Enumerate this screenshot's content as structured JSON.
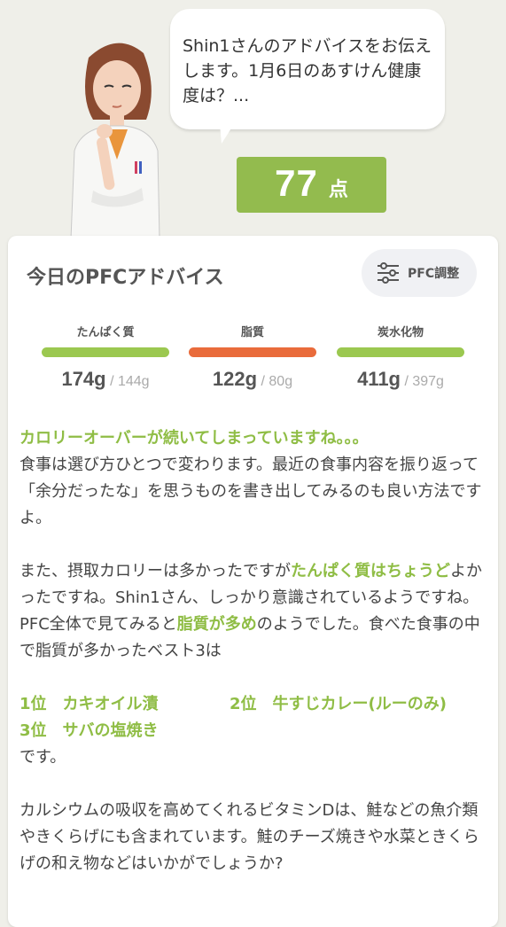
{
  "speech": {
    "text": "Shin1さんのアドバイスをお伝えします。1月6日のあすけん健康度は？..."
  },
  "score": {
    "value": "77",
    "unit": "点"
  },
  "card": {
    "title": "今日のPFCアドバイス",
    "pfc_button": "PFC調整"
  },
  "nutrients": [
    {
      "label": "たんぱく質",
      "value": "174g",
      "target": "144g",
      "color": "#9bc850"
    },
    {
      "label": "脂質",
      "value": "122g",
      "target": "80g",
      "color": "#e96b3b"
    },
    {
      "label": "炭水化物",
      "value": "411g",
      "target": "397g",
      "color": "#9bc850"
    }
  ],
  "advice": {
    "p1_headline": "カロリーオーバーが続いてしまっていますね。。。",
    "p1_body": "食事は選び方ひとつで変わります。最近の食事内容を振り返って「余分だったな」を思うものを書き出してみるのも良い方法ですよ。",
    "p2_a": "また、摂取カロリーは多かったですが",
    "p2_hl": "たんぱく質はちょうど",
    "p2_b": "よかったですね。Shin1さん、しっかり意識されているようですね。",
    "p3_a": "PFC全体で見てみると",
    "p3_hl": "脂質が多め",
    "p3_b": "のようでした。食べた食事の中で脂質が多かったベスト3は",
    "rank1": "1位　カキオイル漬",
    "rank2": "2位　牛すじカレー(ルーのみ)",
    "rank3": "3位　サバの塩焼き",
    "desu": "です。",
    "p4": "カルシウムの吸収を高めてくれるビタミンDは、鮭などの魚介類やきくらげにも含まれています。鮭のチーズ焼きや水菜ときくらげの和え物などはいかがでしょうか?"
  },
  "colors": {
    "accent_green": "#93bb4e",
    "fat_orange": "#e96b3b",
    "background": "#efefe9"
  }
}
